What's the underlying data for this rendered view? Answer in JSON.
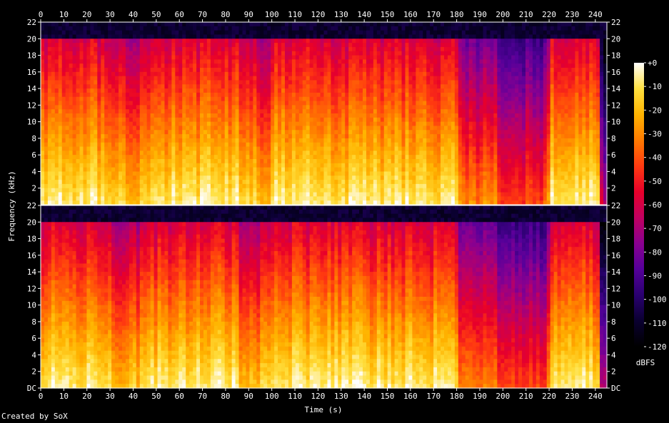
{
  "chart_data": {
    "type": "heatmap",
    "title": "",
    "xlabel": "Time (s)",
    "ylabel": "Frequency (kHz)",
    "xlim": [
      0,
      245
    ],
    "ylim": [
      0,
      22
    ],
    "x_ticks": [
      "0",
      "10",
      "20",
      "30",
      "40",
      "50",
      "60",
      "70",
      "80",
      "90",
      "100",
      "110",
      "120",
      "130",
      "140",
      "150",
      "160",
      "170",
      "180",
      "190",
      "200",
      "210",
      "220",
      "230",
      "240"
    ],
    "y_ticks": [
      "DC",
      "2",
      "4",
      "6",
      "8",
      "10",
      "12",
      "14",
      "16",
      "18",
      "20",
      "22"
    ],
    "channels": 2,
    "colorbar": {
      "label": "dBFS",
      "ticks": [
        "+0",
        "-10",
        "-20",
        "-30",
        "-40",
        "-50",
        "-60",
        "-70",
        "-80",
        "-90",
        "-100",
        "-110",
        "-120"
      ],
      "range": [
        -120,
        0
      ]
    },
    "palette": [
      "#000000",
      "#0a0030",
      "#2a0070",
      "#55009a",
      "#8a0090",
      "#c00060",
      "#e8002a",
      "#ff3a10",
      "#ff7a00",
      "#ffb400",
      "#ffe040",
      "#ffffff"
    ]
  },
  "footer": {
    "creator": "Created by SoX"
  }
}
